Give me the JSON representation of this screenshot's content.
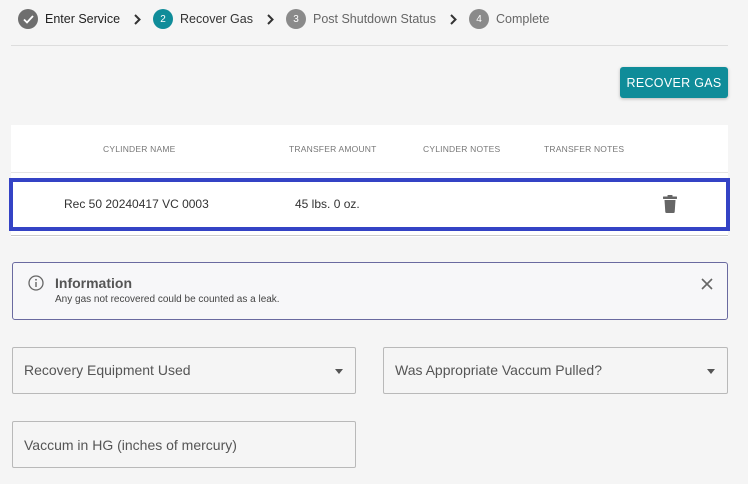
{
  "stepper": {
    "steps": [
      {
        "number": "",
        "label": "Enter Service",
        "state": "done"
      },
      {
        "number": "2",
        "label": "Recover Gas",
        "state": "active"
      },
      {
        "number": "3",
        "label": "Post Shutdown Status",
        "state": "pending"
      },
      {
        "number": "4",
        "label": "Complete",
        "state": "pending"
      }
    ]
  },
  "actions": {
    "recover_gas": "RECOVER GAS"
  },
  "table": {
    "headers": [
      "CYLINDER NAME",
      "TRANSFER AMOUNT",
      "CYLINDER NOTES",
      "TRANSFER NOTES"
    ],
    "rows": [
      {
        "cylinder_name": "Rec 50 20240417 VC 0003",
        "transfer_amount": "45 lbs. 0 oz.",
        "cylinder_notes": "",
        "transfer_notes": ""
      }
    ]
  },
  "info": {
    "title": "Information",
    "message": "Any gas not recovered could be counted as a leak."
  },
  "form": {
    "recovery_equipment": "Recovery Equipment Used",
    "vacuum_pulled": "Was Appropriate Vaccum Pulled?",
    "vacuum_hg": "Vaccum in HG (inches of mercury)"
  },
  "colors": {
    "accent": "#0f8c99",
    "row_highlight": "#3443c5",
    "done_step": "#6e6e6e"
  }
}
